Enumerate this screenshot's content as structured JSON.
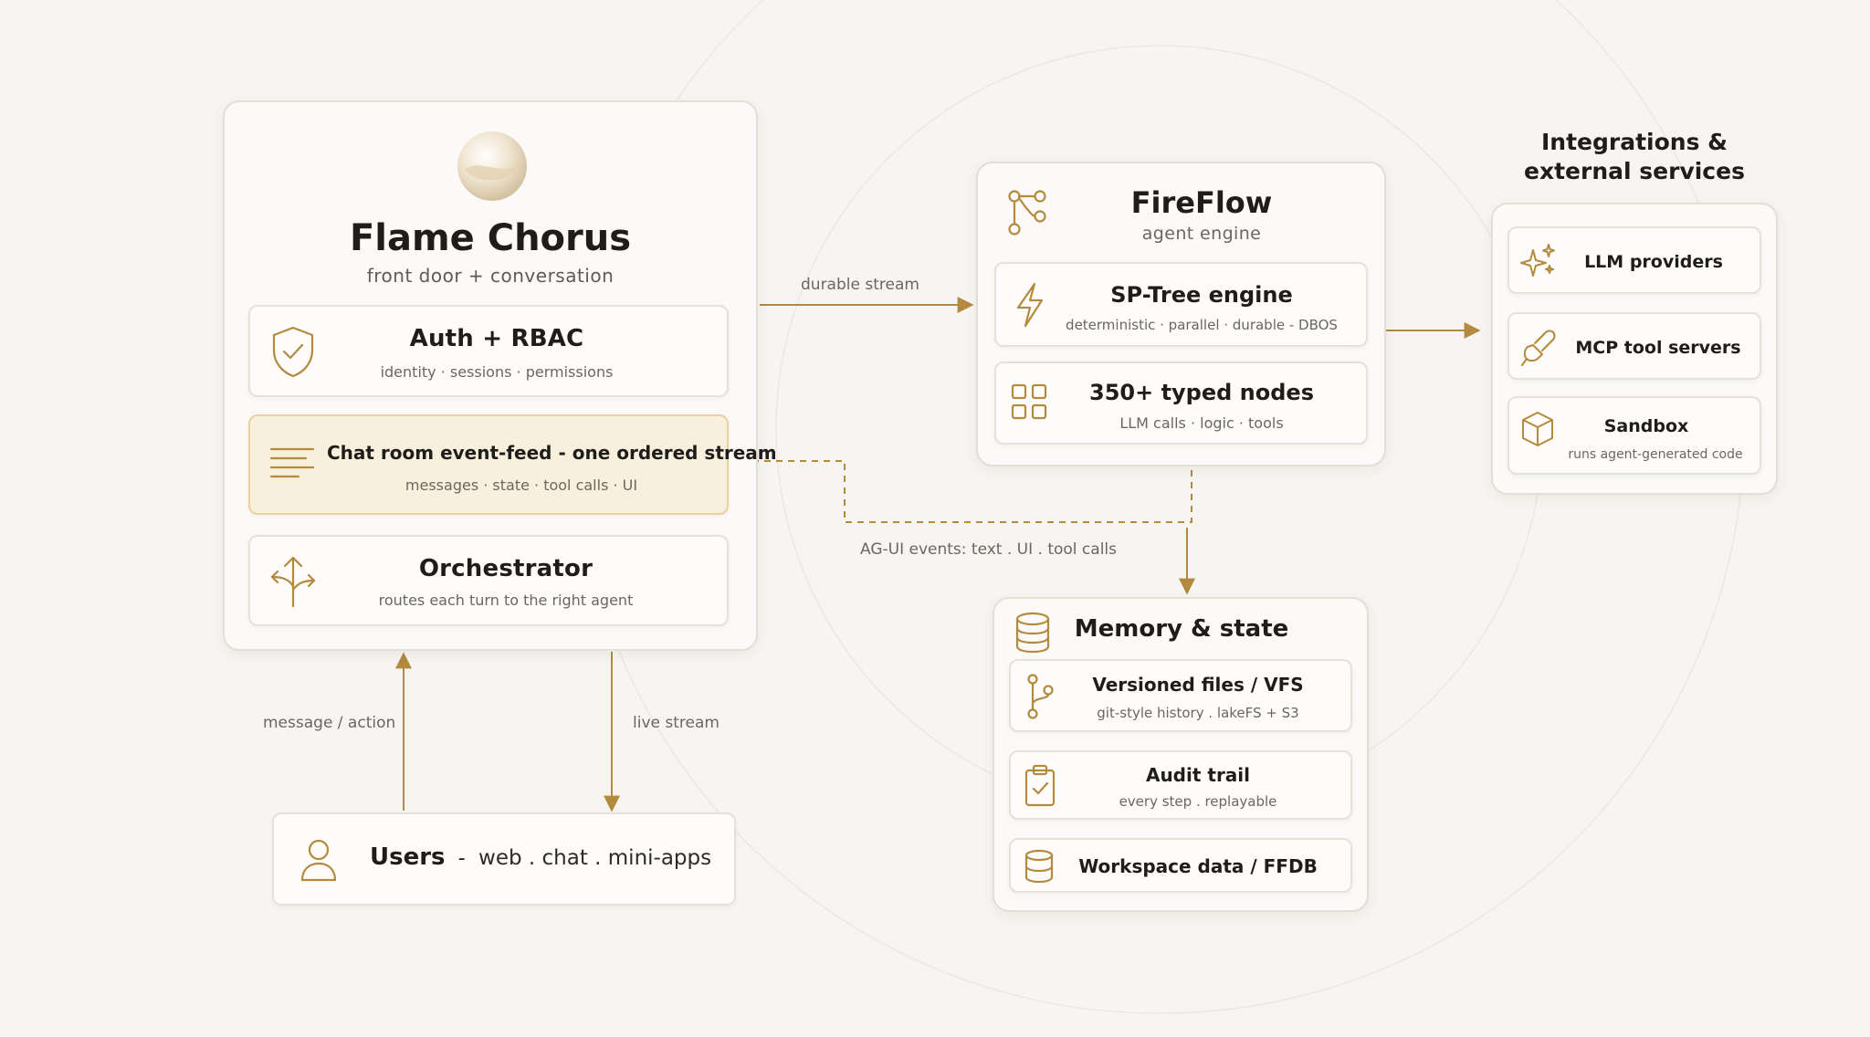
{
  "front": {
    "title": "Flame Chorus",
    "subtitle": "front door + conversation",
    "auth": {
      "title": "Auth + RBAC",
      "sub": "identity · sessions · permissions"
    },
    "feed": {
      "title": "Chat room event-feed - one ordered stream",
      "sub": "messages · state · tool calls · UI"
    },
    "orch": {
      "title": "Orchestrator",
      "sub": "routes each turn to the right agent"
    }
  },
  "users": {
    "title": "Users",
    "sep": "-",
    "detail": "web . chat . mini-apps"
  },
  "engine": {
    "title": "FireFlow",
    "subtitle": "agent engine",
    "sptree": {
      "title": "SP-Tree engine",
      "sub": "deterministic · parallel · durable - DBOS"
    },
    "nodes": {
      "title": "350+ typed nodes",
      "sub": "LLM calls · logic · tools"
    }
  },
  "memory": {
    "title": "Memory & state",
    "vfs": {
      "title": "Versioned files / VFS",
      "sub": "git-style history . lakeFS + S3"
    },
    "audit": {
      "title": "Audit trail",
      "sub": "every step . replayable"
    },
    "ffdb": {
      "title": "Workspace data / FFDB"
    }
  },
  "integrations": {
    "heading_line1": "Integrations &",
    "heading_line2": "external services",
    "llm": "LLM providers",
    "mcp": "MCP tool servers",
    "sandbox": {
      "title": "Sandbox",
      "sub": "runs agent-generated code"
    }
  },
  "edges": {
    "durable": "durable stream",
    "agui": "AG-UI events: text . UI . tool calls",
    "message": "message / action",
    "live": "live stream"
  },
  "icons": [
    "orb-logo",
    "shield-check-icon",
    "lines-icon",
    "split-arrows-icon",
    "user-icon",
    "share-nodes-icon",
    "lightning-icon",
    "grid-icon",
    "database-icon",
    "git-branch-icon",
    "clipboard-check-icon",
    "sparkles-icon",
    "plug-icon",
    "cube-icon"
  ],
  "colors": {
    "accent": "#b38a3e",
    "background": "#f7f5f1",
    "highlight": "#f8f0dd"
  }
}
